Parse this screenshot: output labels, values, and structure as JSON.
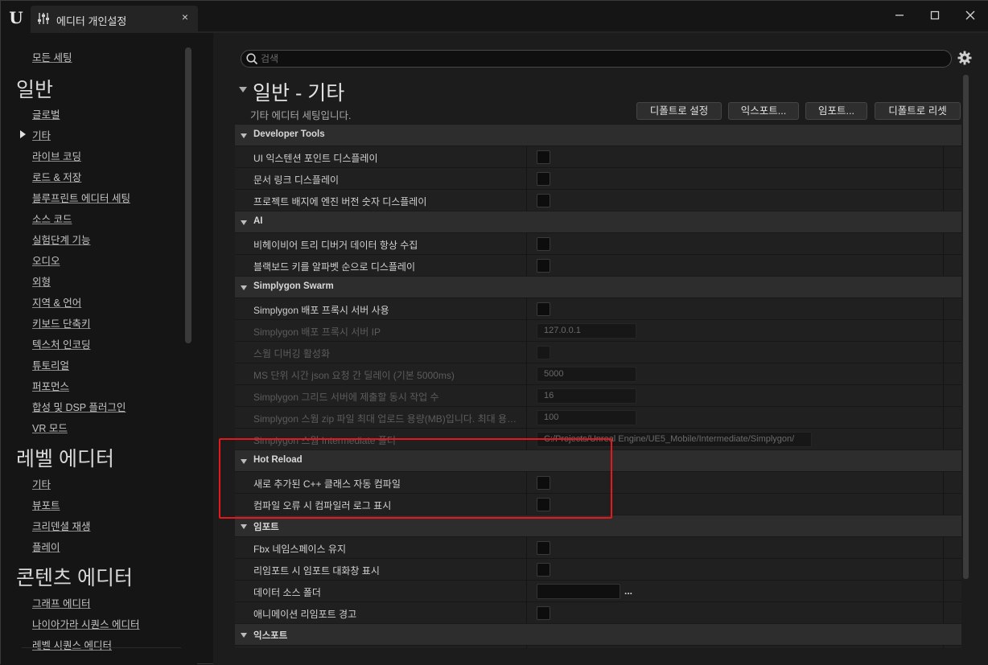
{
  "tab": {
    "title": "에디터 개인설정",
    "close": "×"
  },
  "window_controls": {
    "minimize": "—",
    "maximize": "☐",
    "close": "✕"
  },
  "sidebar": {
    "top_item": "모든 세팅",
    "categories": [
      {
        "title": "일반",
        "items": [
          "글로벌",
          "기타",
          "라이브 코딩",
          "로드 & 저장",
          "블루프린트 에디터 세팅",
          "소스 코드",
          "실험단계 기능",
          "오디오",
          "외형",
          "지역 & 언어",
          "키보드 단축키",
          "텍스처 인코딩",
          "튜토리얼",
          "퍼포먼스",
          "합성 및 DSP 플러그인",
          "VR 모드"
        ]
      },
      {
        "title": "레벨 에디터",
        "items": [
          "기타",
          "뷰포트",
          "크리덴셜 재생",
          "플레이"
        ]
      },
      {
        "title": "콘텐츠 에디터",
        "items": [
          "그래프 에디터",
          "나이아가라 시퀀스 에디터",
          "레벨 시퀀스 에디터"
        ]
      }
    ],
    "selected": "기타"
  },
  "search": {
    "placeholder": "검색"
  },
  "section": {
    "title": "일반 - 기타",
    "description": "기타 에디터 세팅입니다."
  },
  "header_buttons": [
    "디폴트로 설정",
    "익스포트...",
    "임포트...",
    "디폴트로 리셋"
  ],
  "groups": [
    {
      "name": "Developer Tools",
      "props": [
        {
          "label": "UI 익스텐션 포인트 디스플레이",
          "type": "checkbox",
          "checked": false,
          "disabled": false
        },
        {
          "label": "문서 링크 디스플레이",
          "type": "checkbox",
          "checked": false,
          "disabled": false
        },
        {
          "label": "프로젝트 배지에 엔진 버전 숫자 디스플레이",
          "type": "checkbox",
          "checked": false,
          "disabled": false
        }
      ]
    },
    {
      "name": "AI",
      "props": [
        {
          "label": "비헤이비어 트리 디버거 데이터 항상 수집",
          "type": "checkbox",
          "checked": false,
          "disabled": false
        },
        {
          "label": "블랙보드 키를 알파벳 순으로 디스플레이",
          "type": "checkbox",
          "checked": false,
          "disabled": false
        }
      ]
    },
    {
      "name": "Simplygon Swarm",
      "props": [
        {
          "label": "Simplygon 배포 프록시 서버 사용",
          "type": "checkbox",
          "checked": false,
          "disabled": false
        },
        {
          "label": "Simplygon 배포 프록시 서버 IP",
          "type": "text",
          "value": "127.0.0.1",
          "disabled": true
        },
        {
          "label": "스웜 디버깅 활성화",
          "type": "checkbox",
          "checked": false,
          "disabled": true
        },
        {
          "label": "MS 단위 시간 json 요청 간 딜레이 (기본 5000ms)",
          "type": "text",
          "value": "5000",
          "disabled": true
        },
        {
          "label": "Simplygon 그리드 서버에 제출할 동시 작업 수",
          "type": "text",
          "value": "16",
          "disabled": true
        },
        {
          "label": "Simplygon 스웜 zip 파일 최대 업로드 용량(MB)입니다. 최대 용량보다...",
          "type": "text",
          "value": "100",
          "disabled": true
        },
        {
          "label": "Simplygon 스웜 Intermediate 폴더",
          "type": "path",
          "value": "C:/Projects/Unreal Engine/UE5_Mobile/Intermediate/Simplygon/",
          "disabled": true
        }
      ]
    },
    {
      "name": "Hot Reload",
      "props": [
        {
          "label": "새로 추가된 C++ 클래스 자동 컴파일",
          "type": "checkbox",
          "checked": false,
          "disabled": false
        },
        {
          "label": "컴파일 오류 시 컴파일러 로그 표시",
          "type": "checkbox",
          "checked": false,
          "disabled": false
        }
      ]
    },
    {
      "name": "임포트",
      "props": [
        {
          "label": "Fbx 네임스페이스 유지",
          "type": "checkbox",
          "checked": false,
          "disabled": false
        },
        {
          "label": "리임포트 시 임포트 대화창 표시",
          "type": "checkbox",
          "checked": false,
          "disabled": false
        },
        {
          "label": "데이터 소스 폴더",
          "type": "folder",
          "value": "",
          "browse": "...",
          "disabled": false
        },
        {
          "label": "애니메이션 리임포트 경고",
          "type": "checkbox",
          "checked": false,
          "disabled": false
        }
      ]
    },
    {
      "name": "익스포트",
      "props": [
        {
          "label": "",
          "type": "checkbox",
          "checked": false,
          "disabled": false
        }
      ]
    }
  ],
  "highlight": {
    "color": "#e5191c",
    "group": "Hot Reload"
  }
}
